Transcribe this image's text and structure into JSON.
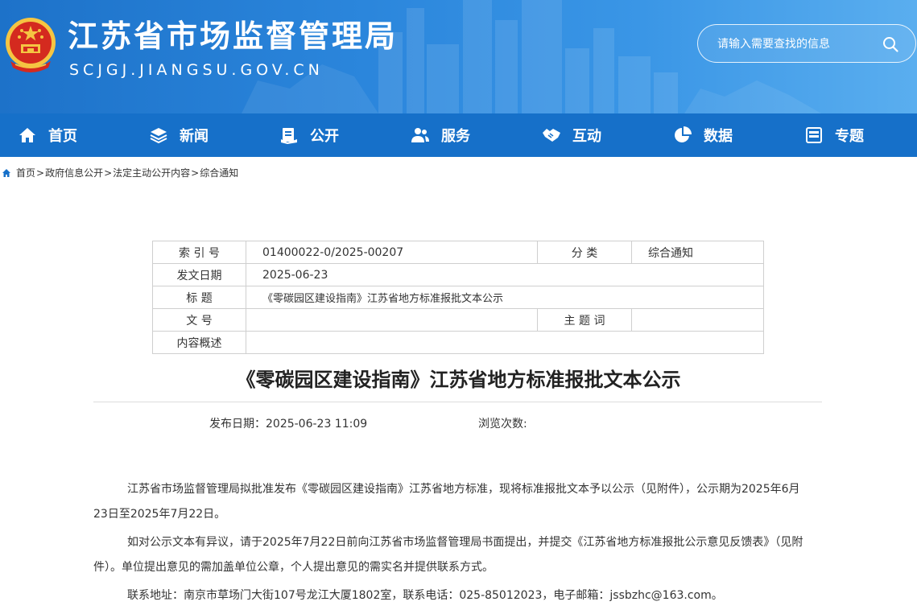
{
  "header": {
    "site_title": "江苏省市场监督管理局",
    "site_domain": "SCJGJ.JIANGSU.GOV.CN",
    "search_placeholder": "请输入需要查找的信息"
  },
  "nav": {
    "items": [
      {
        "label": "首页",
        "icon": "home-icon"
      },
      {
        "label": "新闻",
        "icon": "layers-icon"
      },
      {
        "label": "公开",
        "icon": "document-icon"
      },
      {
        "label": "服务",
        "icon": "users-icon"
      },
      {
        "label": "互动",
        "icon": "handshake-icon"
      },
      {
        "label": "数据",
        "icon": "pie-chart-icon"
      },
      {
        "label": "专题",
        "icon": "window-icon"
      }
    ]
  },
  "breadcrumb": {
    "items": [
      "首页",
      "政府信息公开",
      "法定主动公开内容",
      "综合通知"
    ],
    "separator": ">"
  },
  "info_table": {
    "index_label": "索 引 号",
    "index_value": "01400022-0/2025-00207",
    "category_label": "分 类",
    "category_value": "综合通知",
    "date_label": "发文日期",
    "date_value": "2025-06-23",
    "title_label": "标 题",
    "title_value": "《零碳园区建设指南》江苏省地方标准报批文本公示",
    "docno_label": "文 号",
    "docno_value": "",
    "keyword_label": "主 题 词",
    "keyword_value": "",
    "summary_label": "内容概述",
    "summary_value": ""
  },
  "article": {
    "title": "《零碳园区建设指南》江苏省地方标准报批文本公示",
    "publish_date": "发布日期：2025-06-23 11:09",
    "views": "浏览次数:",
    "paragraphs": [
      "江苏省市场监督管理局拟批准发布《零碳园区建设指南》江苏省地方标准，现将标准报批文本予以公示（见附件），公示期为2025年6月23日至2025年7月22日。",
      "如对公示文本有异议，请于2025年7月22日前向江苏省市场监督管理局书面提出，并提交《江苏省地方标准报批公示意见反馈表》（见附件）。单位提出意见的需加盖单位公章，个人提出意见的需实名并提供联系方式。",
      "联系地址：南京市草场门大街107号龙江大厦1802室，联系电话：025-85012023，电子邮箱：jssbzhc@163.com。"
    ]
  },
  "colors": {
    "header_blue": "#2b86dc",
    "nav_blue": "#1670c9",
    "emblem_red": "#d42a1f",
    "emblem_gold": "#f5c542"
  }
}
